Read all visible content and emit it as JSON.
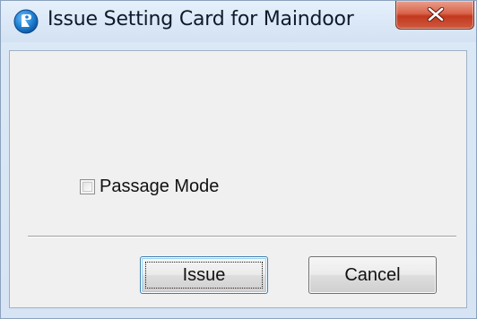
{
  "window": {
    "title": "Issue Setting Card for Maindoor",
    "icon": "app-logo-icon",
    "close_icon": "close-icon"
  },
  "form": {
    "passage_mode": {
      "label": "Passage Mode",
      "checked": false
    }
  },
  "buttons": {
    "issue_label": "Issue",
    "cancel_label": "Cancel"
  },
  "colors": {
    "titlebar": "#dbe8f7",
    "client_background": "#f0f0f0",
    "close_button": "#c2391f",
    "focus_border": "#3c7fb1",
    "app_icon": "#1f7fd0"
  }
}
